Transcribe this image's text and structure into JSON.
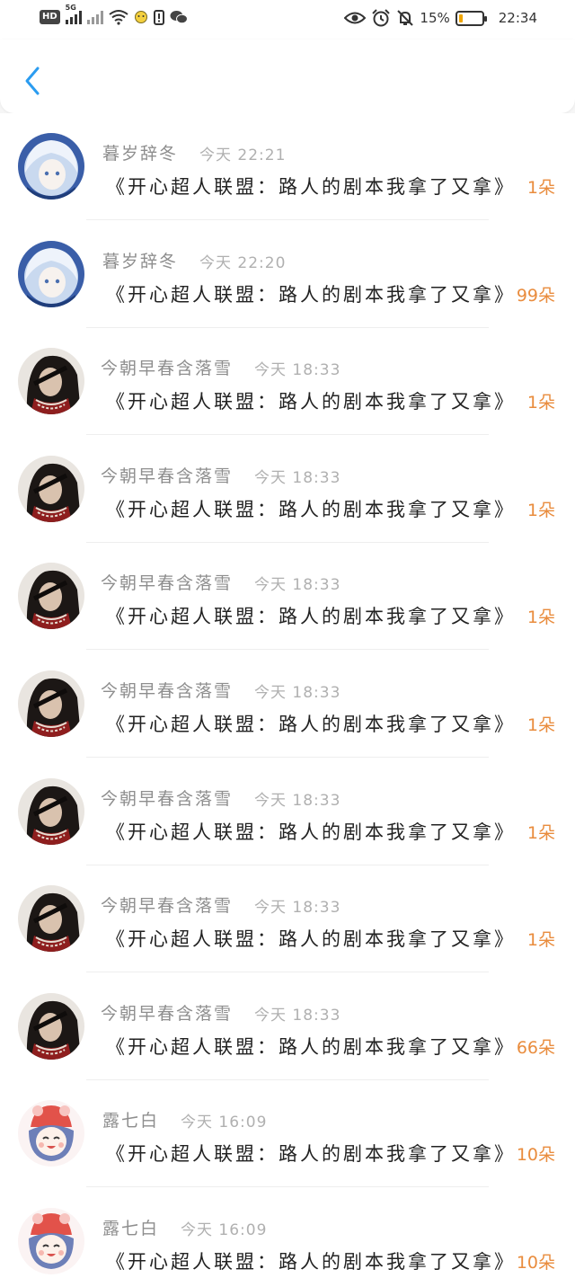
{
  "status_bar": {
    "hd": "HD",
    "net": "5G",
    "battery_text": "15%",
    "clock": "22:34",
    "battery_level": 0.15,
    "icons": [
      "hd-icon",
      "signal-icon",
      "no-signal-icon",
      "wifi-icon",
      "notification-icon",
      "alert-icon",
      "wechat-icon",
      "eye-icon",
      "alarm-icon",
      "mute-icon",
      "battery-icon"
    ]
  },
  "nav": {
    "back_icon": "chevron-left-icon",
    "accent": "#2b9cf0"
  },
  "colors": {
    "count": "#e98c3d",
    "username": "#8e8e8e",
    "time": "#b0b0b0"
  },
  "items": [
    {
      "avatar": "avatar-white-hair",
      "user": "暮岁辞冬",
      "time": "今天 22:21",
      "title": "《开心超人联盟：路人的剧本我拿了又拿》",
      "count": "1朵"
    },
    {
      "avatar": "avatar-white-hair",
      "user": "暮岁辞冬",
      "time": "今天 22:20",
      "title": "《开心超人联盟：路人的剧本我拿了又拿》",
      "count": "99朵"
    },
    {
      "avatar": "avatar-dark-hair",
      "user": "今朝早春含落雪",
      "time": "今天 18:33",
      "title": "《开心超人联盟：路人的剧本我拿了又拿》",
      "count": "1朵"
    },
    {
      "avatar": "avatar-dark-hair",
      "user": "今朝早春含落雪",
      "time": "今天 18:33",
      "title": "《开心超人联盟：路人的剧本我拿了又拿》",
      "count": "1朵"
    },
    {
      "avatar": "avatar-dark-hair",
      "user": "今朝早春含落雪",
      "time": "今天 18:33",
      "title": "《开心超人联盟：路人的剧本我拿了又拿》",
      "count": "1朵"
    },
    {
      "avatar": "avatar-dark-hair",
      "user": "今朝早春含落雪",
      "time": "今天 18:33",
      "title": "《开心超人联盟：路人的剧本我拿了又拿》",
      "count": "1朵"
    },
    {
      "avatar": "avatar-dark-hair",
      "user": "今朝早春含落雪",
      "time": "今天 18:33",
      "title": "《开心超人联盟：路人的剧本我拿了又拿》",
      "count": "1朵"
    },
    {
      "avatar": "avatar-dark-hair",
      "user": "今朝早春含落雪",
      "time": "今天 18:33",
      "title": "《开心超人联盟：路人的剧本我拿了又拿》",
      "count": "1朵"
    },
    {
      "avatar": "avatar-dark-hair",
      "user": "今朝早春含落雪",
      "time": "今天 18:33",
      "title": "《开心超人联盟：路人的剧本我拿了又拿》",
      "count": "66朵"
    },
    {
      "avatar": "avatar-chibi",
      "user": "露七白",
      "time": "今天 16:09",
      "title": "《开心超人联盟：路人的剧本我拿了又拿》",
      "count": "10朵"
    },
    {
      "avatar": "avatar-chibi",
      "user": "露七白",
      "time": "今天 16:09",
      "title": "《开心超人联盟：路人的剧本我拿了又拿》",
      "count": "10朵"
    }
  ]
}
